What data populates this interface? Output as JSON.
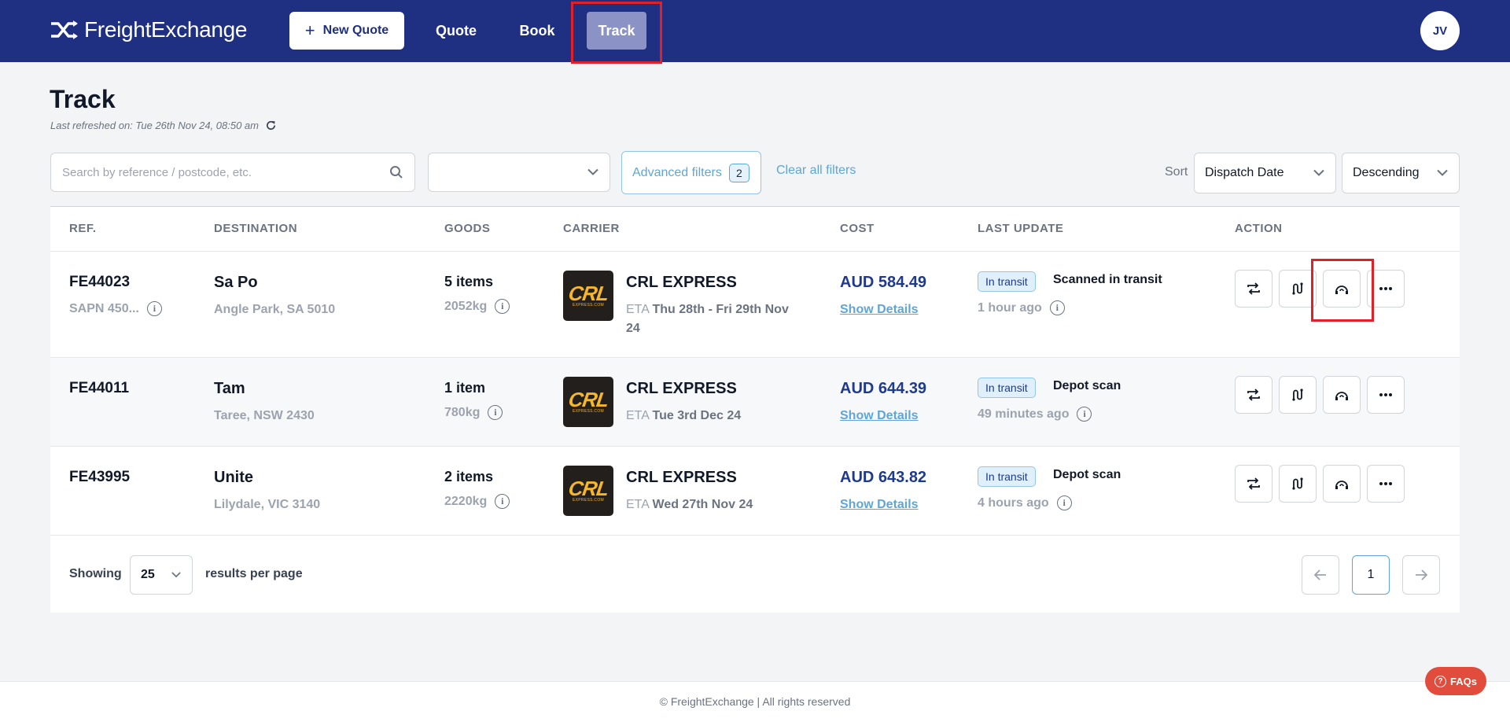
{
  "header": {
    "brand": "FreightExchange",
    "new_quote_label": "New Quote",
    "nav": {
      "quote": "Quote",
      "book": "Book",
      "track": "Track"
    },
    "avatar_initials": "JV"
  },
  "page": {
    "title": "Track",
    "last_refreshed": "Last refreshed on: Tue 26th Nov 24, 08:50 am"
  },
  "filters": {
    "search_placeholder": "Search by reference / postcode, etc.",
    "select_value": "",
    "advanced_filters_label": "Advanced filters",
    "advanced_filters_count": "2",
    "clear_all_label": "Clear all filters",
    "sort_label": "Sort",
    "sort_field": "Dispatch Date",
    "sort_direction": "Descending"
  },
  "table": {
    "columns": [
      "REF.",
      "DESTINATION",
      "GOODS",
      "CARRIER",
      "COST",
      "LAST UPDATE",
      "ACTION"
    ],
    "rows": [
      {
        "ref": "FE44023",
        "ref_sub": "SAPN 450...",
        "dest_name": "Sa Po",
        "dest_location": "Angle Park, SA 5010",
        "goods_items": "5 items",
        "goods_weight": "2052kg",
        "carrier": "CRL EXPRESS",
        "eta_label": "ETA",
        "eta": "Thu 28th - Fri 29th Nov 24",
        "cost": "AUD 584.49",
        "details_label": "Show Details",
        "status_badge": "In transit",
        "status_text": "Scanned in transit",
        "updated": "1 hour ago"
      },
      {
        "ref": "FE44011",
        "ref_sub": "",
        "dest_name": "Tam",
        "dest_location": "Taree, NSW 2430",
        "goods_items": "1 item",
        "goods_weight": "780kg",
        "carrier": "CRL EXPRESS",
        "eta_label": "ETA",
        "eta": "Tue 3rd Dec 24",
        "cost": "AUD 644.39",
        "details_label": "Show Details",
        "status_badge": "In transit",
        "status_text": "Depot scan",
        "updated": "49 minutes ago"
      },
      {
        "ref": "FE43995",
        "ref_sub": "",
        "dest_name": "Unite",
        "dest_location": "Lilydale, VIC 3140",
        "goods_items": "2 items",
        "goods_weight": "2220kg",
        "carrier": "CRL EXPRESS",
        "eta_label": "ETA",
        "eta": "Wed 27th Nov 24",
        "cost": "AUD 643.82",
        "details_label": "Show Details",
        "status_badge": "In transit",
        "status_text": "Depot scan",
        "updated": "4 hours ago"
      }
    ]
  },
  "carrier_logo": {
    "text": "CRL",
    "sub": "EXPRESS.COM"
  },
  "pagination": {
    "showing_label": "Showing",
    "per_page": "25",
    "results_label": "results per page",
    "current_page": "1"
  },
  "footer": {
    "copyright": "© FreightExchange | All rights reserved",
    "faqs_label": "FAQs"
  },
  "colors": {
    "topbar": "#1f2f82",
    "nav_active": "#8b93c6",
    "highlight": "#e02228",
    "link": "#5ea6d6",
    "cost": "#1f3a8a",
    "faqs": "#e14c3c"
  },
  "icons": {
    "brand": "shuffle-icon",
    "new_quote": "plus-icon",
    "refresh": "refresh-icon",
    "search": "search-icon",
    "dropdown": "chevron-down-icon",
    "actions": [
      "repeat-icon",
      "route-icon",
      "support-icon",
      "more-icon"
    ],
    "prev": "arrow-left-icon",
    "next": "arrow-right-icon",
    "help": "question-circle-icon"
  }
}
